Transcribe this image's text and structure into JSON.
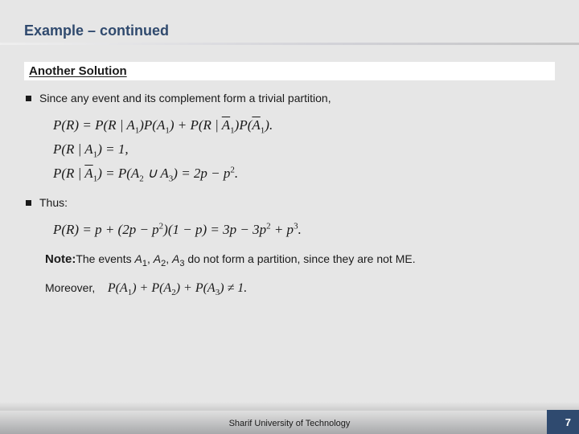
{
  "title": "Example – continued",
  "subhead": "Another Solution",
  "bullets": {
    "b1": "Since any event and its complement form a trivial partition,",
    "b2": "Thus:"
  },
  "eq": {
    "e1_pre": "P(R) = P(R | A",
    "e1_s1": "1",
    "e1_mid1": ")P(A",
    "e1_s2": "1",
    "e1_mid2": ") + P(R | ",
    "e1_bar1": "A",
    "e1_s3": "1",
    "e1_mid3": ")P(",
    "e1_bar2": "A",
    "e1_s4": "1",
    "e1_end": ").",
    "e2_pre": "P(R | A",
    "e2_s1": "1",
    "e2_end": ") = 1,",
    "e3_pre": "P(R | ",
    "e3_bar": "A",
    "e3_s1": "1",
    "e3_mid1": ") = P(A",
    "e3_s2": "2",
    "e3_mid2": " ∪ A",
    "e3_s3": "3",
    "e3_mid3": ") = 2p − p",
    "e3_sup": "2",
    "e3_end": ".",
    "e4_pre": "P(R) = p + (2p − p",
    "e4_sup1": "2",
    "e4_mid1": ")(1 − p) = 3p − 3p",
    "e4_sup2": "2",
    "e4_mid2": " + p",
    "e4_sup3": "3",
    "e4_end": ".",
    "moreover_pre": "P(A",
    "moreover_s1": "1",
    "moreover_mid1": ") + P(A",
    "moreover_s2": "2",
    "moreover_mid2": ") + P(A",
    "moreover_s3": "3",
    "moreover_end": ") ≠ 1."
  },
  "note": {
    "label": "Note:",
    "pre": "The events ",
    "a": "A",
    "s1": "1",
    "c12": ", ",
    "s2": "2",
    "c23": ", ",
    "s3": "3",
    "postpunct": " ",
    "rest": "do not form a partition, since they are not ME."
  },
  "moreover_label": "Moreover,",
  "footer": "Sharif University of Technology",
  "page": "7"
}
